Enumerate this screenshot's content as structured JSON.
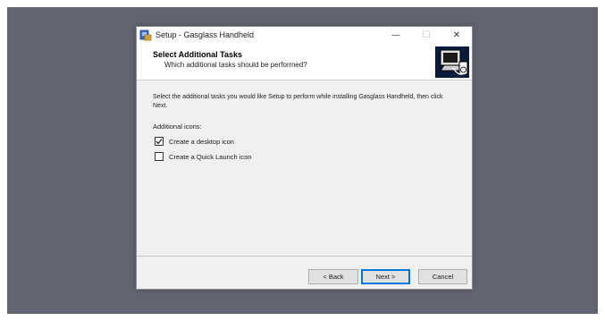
{
  "window": {
    "title": "Setup - Gasglass Handheld",
    "controls": {
      "minimize": "—",
      "maximize": "☐",
      "close": "✕"
    }
  },
  "header": {
    "title": "Select Additional Tasks",
    "subtitle": "Which additional tasks should be performed?",
    "image_icon": "computer-install-icon"
  },
  "body": {
    "intro": "Select the additional tasks you would like Setup to perform while installing Gasglass Handheld, then click Next.",
    "section_label": "Additional icons:",
    "tasks": [
      {
        "label": "Create a desktop icon",
        "checked": true
      },
      {
        "label": "Create a Quick Launch icon",
        "checked": false
      }
    ]
  },
  "buttons": {
    "back": "< Back",
    "next": "Next >",
    "cancel": "Cancel"
  },
  "colors": {
    "desktop": "#646470",
    "window_bg": "#f0f0f0",
    "accent": "#0078d7"
  }
}
